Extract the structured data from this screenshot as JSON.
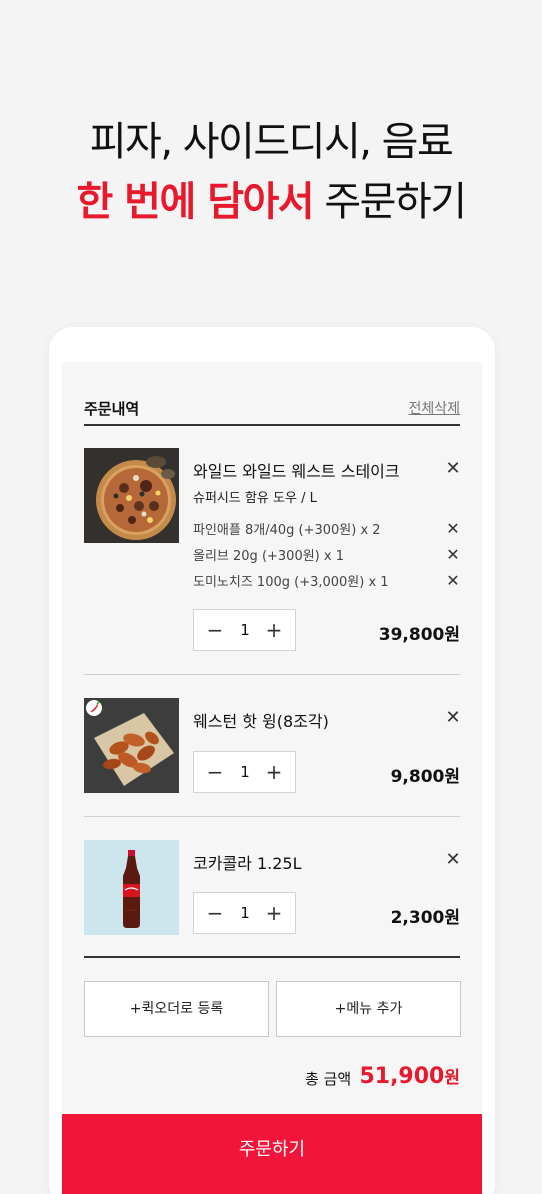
{
  "hero": {
    "line1": "피자, 사이드디시, 음료",
    "line2_accent": "한 번에 담아서",
    "line2_rest": "주문하기"
  },
  "order": {
    "section_title": "주문내역",
    "clear_all": "전체삭제",
    "remove_glyph": "✕",
    "minus_glyph": "−",
    "plus_glyph": "+",
    "items": [
      {
        "name": "와일드 와일드 웨스트 스테이크",
        "sub": "슈퍼시드 함유 도우 / L",
        "options": [
          "파인애플 8개/40g (+300원) x 2",
          "올리브 20g (+300원) x 1",
          "도미노치즈 100g (+3,000원) x 1"
        ],
        "qty": "1",
        "price": "39,800원",
        "icon": "pizza-image"
      },
      {
        "name": "웨스턴 핫 윙(8조각)",
        "qty": "1",
        "price": "9,800원",
        "icon": "chicken-wings-image",
        "badge_icon": "chili-pepper-icon"
      },
      {
        "name": "코카콜라 1.25L",
        "qty": "1",
        "price": "2,300원",
        "icon": "cola-bottle-image"
      }
    ],
    "quick_order_button": "+퀵오더로 등록",
    "add_menu_button": "+메뉴 추가",
    "total_label": "총 금액",
    "total_value": "51,900",
    "total_unit": "원",
    "order_button": "주문하기"
  },
  "colors": {
    "accent": "#e8192c",
    "order_button": "#f2153a",
    "background": "#f4f4f4"
  }
}
